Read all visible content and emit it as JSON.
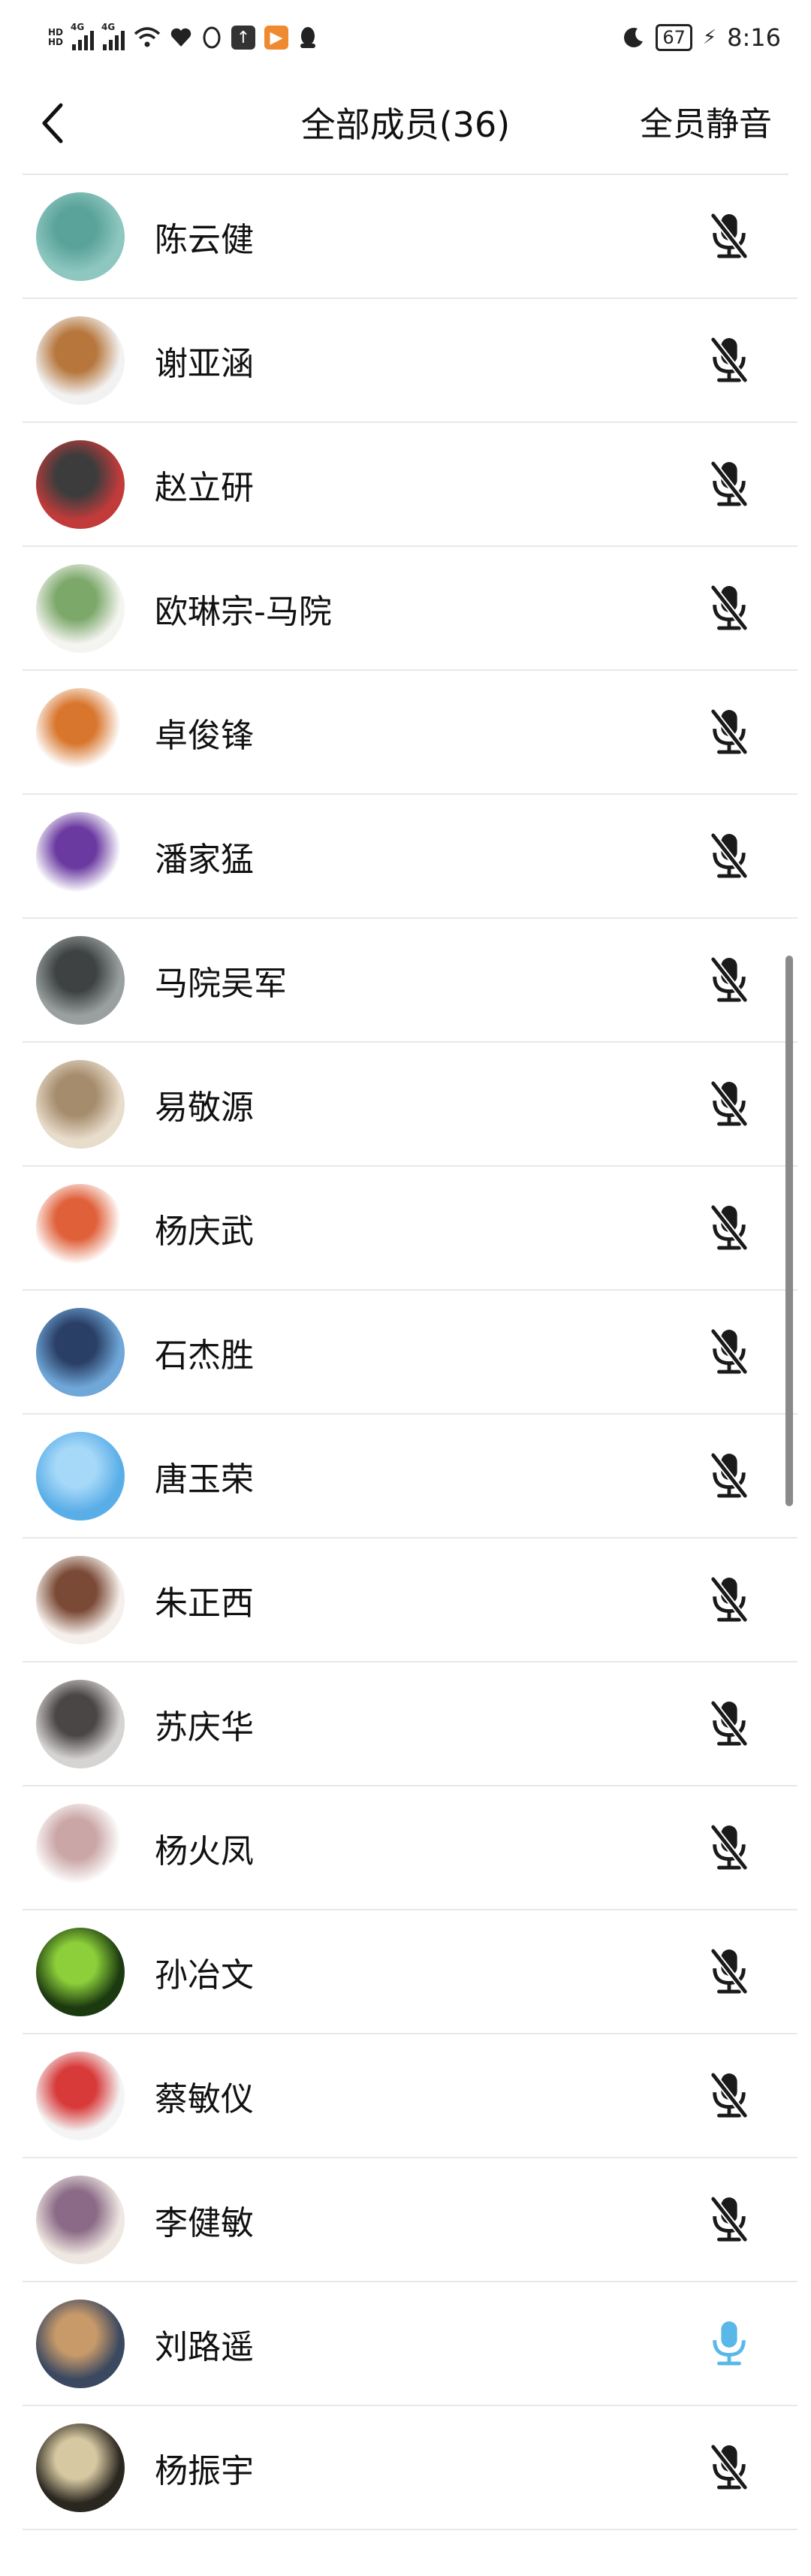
{
  "status_bar": {
    "network_labels": [
      "4G",
      "4G"
    ],
    "battery": "67",
    "time": "8:16",
    "icons": [
      "hd-icon",
      "signal-icon",
      "signal-icon",
      "wifi-icon",
      "heart-icon",
      "qq-icon",
      "upload-icon",
      "video-app-icon",
      "qq-penguin-icon",
      "moon-icon",
      "battery-icon",
      "charging-icon"
    ]
  },
  "header": {
    "title": "全部成员(36)",
    "mute_all": "全员静音",
    "back_icon": "chevron-left-icon"
  },
  "colors": {
    "mic_muted": "#1a1a1a",
    "mic_active": "#5ab8e8",
    "divider": "#e8e8e8"
  },
  "members": [
    {
      "name": "陈云健",
      "muted": true,
      "avatar_colors": [
        "#8ec7c0",
        "#5aa39a"
      ]
    },
    {
      "name": "谢亚涵",
      "muted": true,
      "avatar_colors": [
        "#f2f2f2",
        "#b6763c"
      ]
    },
    {
      "name": "赵立研",
      "muted": true,
      "avatar_colors": [
        "#c23b3b",
        "#3c3c3c"
      ]
    },
    {
      "name": "欧琳宗-马院",
      "muted": true,
      "avatar_colors": [
        "#f4f4f0",
        "#7ca86a"
      ]
    },
    {
      "name": "卓俊锋",
      "muted": true,
      "avatar_colors": [
        "#ffffff",
        "#d8762e"
      ]
    },
    {
      "name": "潘家猛",
      "muted": true,
      "avatar_colors": [
        "#ffffff",
        "#6a3aa0"
      ]
    },
    {
      "name": "马院吴军",
      "muted": true,
      "avatar_colors": [
        "#9aa0a0",
        "#3e4242"
      ]
    },
    {
      "name": "易敬源",
      "muted": true,
      "avatar_colors": [
        "#e8dccb",
        "#a58c6c"
      ]
    },
    {
      "name": "杨庆武",
      "muted": true,
      "avatar_colors": [
        "#ffffff",
        "#e0603a"
      ]
    },
    {
      "name": "石杰胜",
      "muted": true,
      "avatar_colors": [
        "#6fa7d8",
        "#2a3f66"
      ]
    },
    {
      "name": "唐玉荣",
      "muted": true,
      "avatar_colors": [
        "#5aaee8",
        "#a6d8f8"
      ]
    },
    {
      "name": "朱正西",
      "muted": true,
      "avatar_colors": [
        "#f6f0ec",
        "#7a4a36"
      ]
    },
    {
      "name": "苏庆华",
      "muted": true,
      "avatar_colors": [
        "#d6d4d2",
        "#4a4646"
      ]
    },
    {
      "name": "杨火凤",
      "muted": true,
      "avatar_colors": [
        "#ffffff",
        "#caa6a6"
      ]
    },
    {
      "name": "孙冶文",
      "muted": true,
      "avatar_colors": [
        "#1c3a10",
        "#8ccf3a"
      ]
    },
    {
      "name": "蔡敏仪",
      "muted": true,
      "avatar_colors": [
        "#f4f4f4",
        "#d83a3a"
      ]
    },
    {
      "name": "李健敏",
      "muted": true,
      "avatar_colors": [
        "#efe7e1",
        "#8a6a86"
      ]
    },
    {
      "name": "刘路遥",
      "muted": false,
      "avatar_colors": [
        "#3a4860",
        "#c89a6a"
      ]
    },
    {
      "name": "杨振宇",
      "muted": true,
      "avatar_colors": [
        "#2a2620",
        "#d6c8a0"
      ]
    }
  ]
}
